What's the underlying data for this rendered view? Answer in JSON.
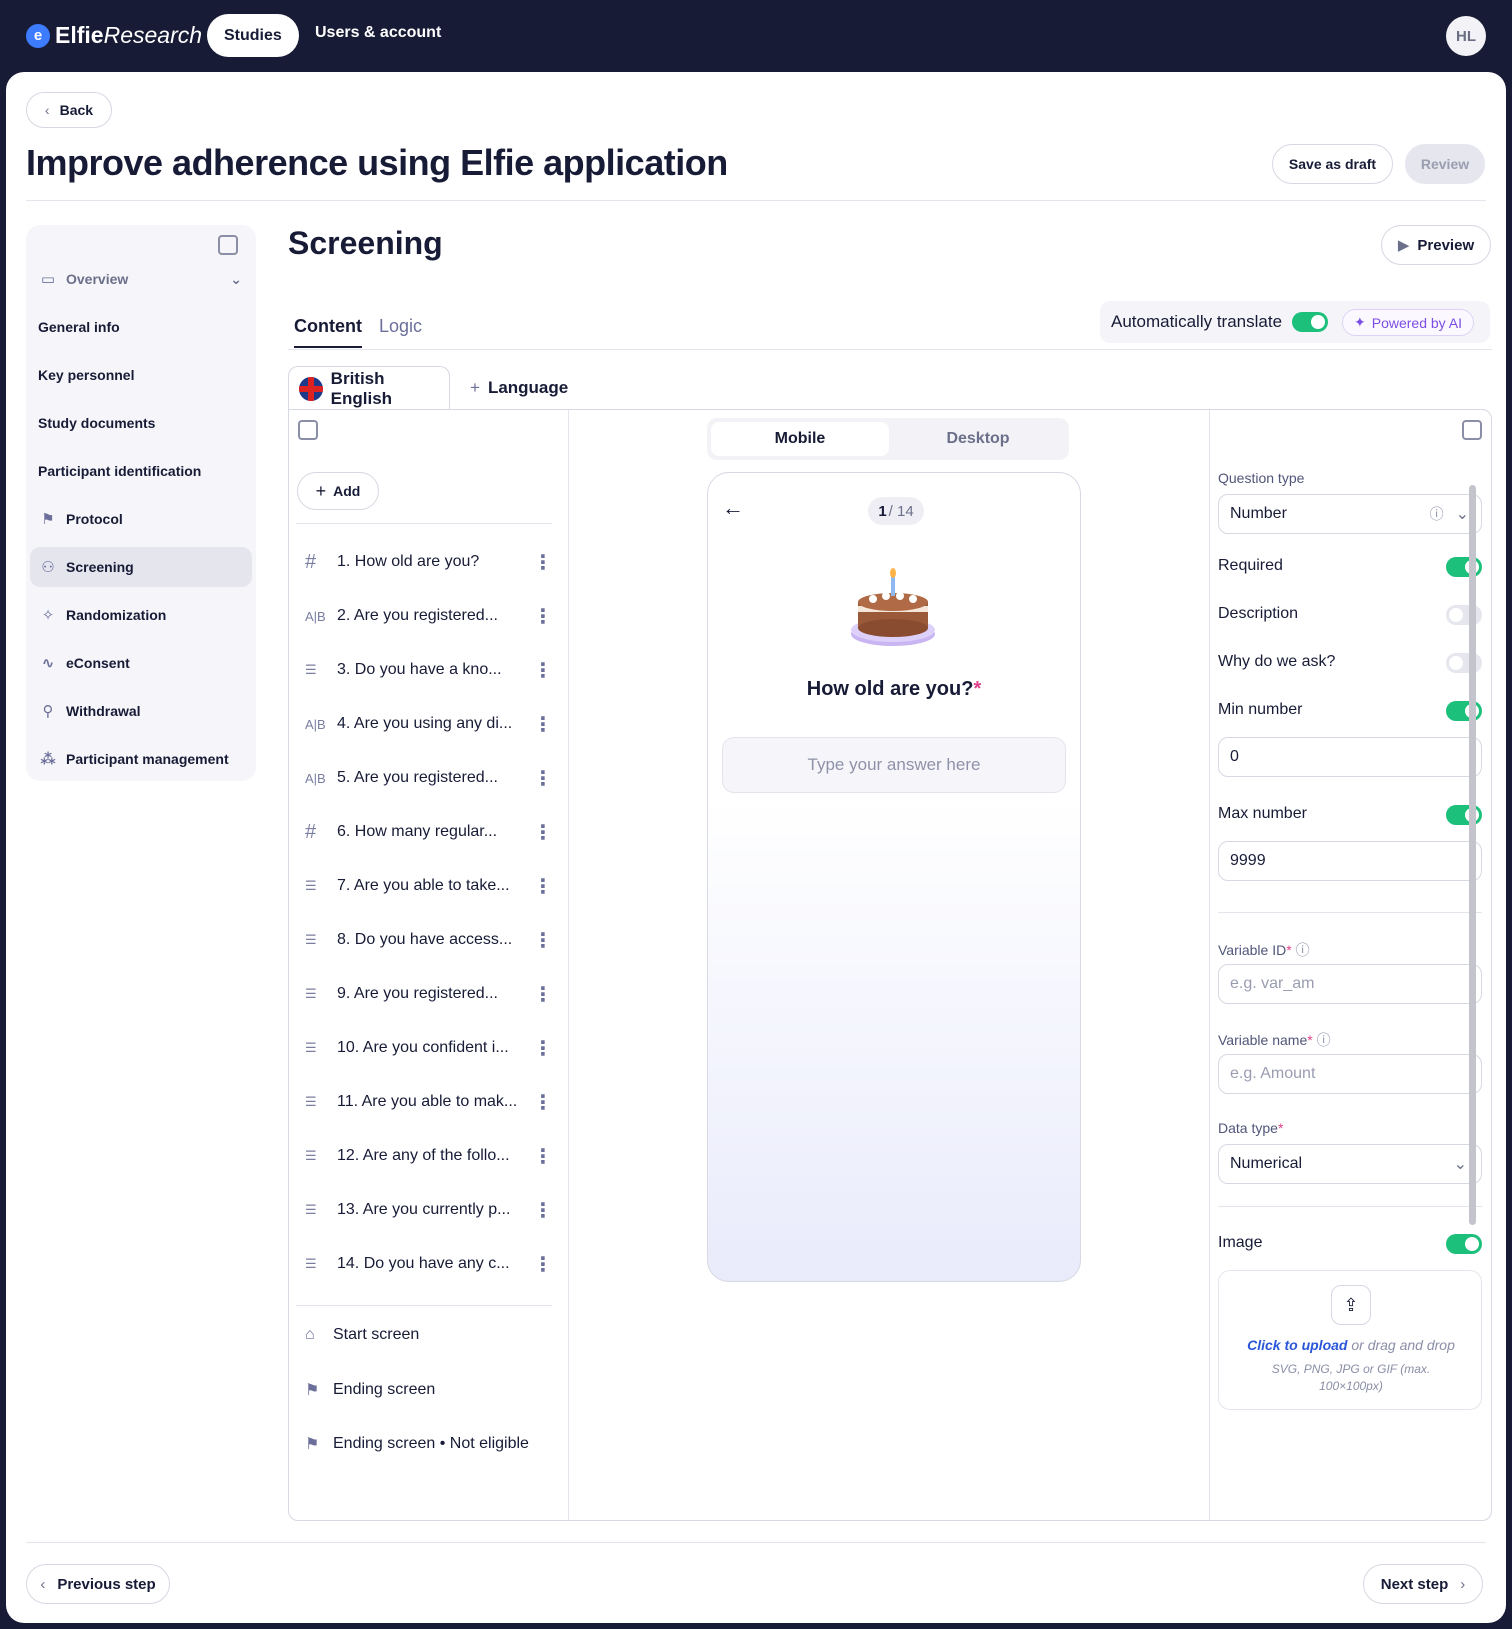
{
  "brand": {
    "name_bold": "Elfie",
    "name_rest": "Research"
  },
  "nav": {
    "studies": "Studies",
    "users": "Users & account"
  },
  "user": {
    "initials": "HL"
  },
  "header": {
    "back": "Back",
    "title": "Improve adherence using Elfie application",
    "save_draft": "Save as draft",
    "review": "Review"
  },
  "sidebar": {
    "overview": "Overview",
    "items": [
      "General info",
      "Key personnel",
      "Study documents",
      "Participant identification",
      "Protocol",
      "Screening",
      "Randomization",
      "eConsent",
      "Withdrawal",
      "Participant management"
    ]
  },
  "section": {
    "title": "Screening",
    "preview": "Preview"
  },
  "tabs": {
    "content": "Content",
    "logic": "Logic"
  },
  "translate": {
    "label": "Automatically translate",
    "badge": "Powered by AI"
  },
  "language": {
    "current": "British English",
    "add": "Language"
  },
  "questions": {
    "add": "Add",
    "items": [
      "1.  How old are you?",
      "2. Are you registered...",
      "3.  Do you have a kno...",
      "4. Are you using any di...",
      "5. Are you registered...",
      "6. How many regular...",
      "7. Are you able to take...",
      "8. Do you have access...",
      "9. Are you registered...",
      "10. Are you confident i...",
      "11. Are you able to mak...",
      "12. Are any of the follo...",
      "13. Are you currently p...",
      "14. Do you have any c..."
    ],
    "start_screen": "Start screen",
    "ending_screen": "Ending screen",
    "ending_not_eligible": "Ending screen • Not eligible"
  },
  "preview_panel": {
    "mobile": "Mobile",
    "desktop": "Desktop",
    "counter_current": "1",
    "counter_total": "/ 14",
    "question": "How old are you?",
    "required_mark": "*",
    "answer_placeholder": "Type your answer here"
  },
  "settings": {
    "question_type_label": "Question type",
    "question_type": "Number",
    "required": "Required",
    "description": "Description",
    "why_ask": "Why do we ask?",
    "min_label": "Min number",
    "min_value": "0",
    "max_label": "Max number",
    "max_value": "9999",
    "variable_id_label": "Variable ID",
    "variable_id_placeholder": "e.g. var_am",
    "variable_name_label": "Variable name",
    "variable_name_placeholder": "e.g. Amount",
    "data_type_label": "Data type",
    "data_type": "Numerical",
    "image": "Image",
    "upload_link": "Click to upload",
    "upload_rest": " or drag and drop",
    "upload_hint": "SVG, PNG, JPG or GIF (max. 100×100px)"
  },
  "footer": {
    "previous": "Previous step",
    "next": "Next step"
  },
  "colors": {
    "navy": "#171b36",
    "toggle_on": "#1cc07a",
    "ai_purple": "#7c4ee4",
    "required_pink": "#e0408a",
    "link_blue": "#2a57d8"
  }
}
